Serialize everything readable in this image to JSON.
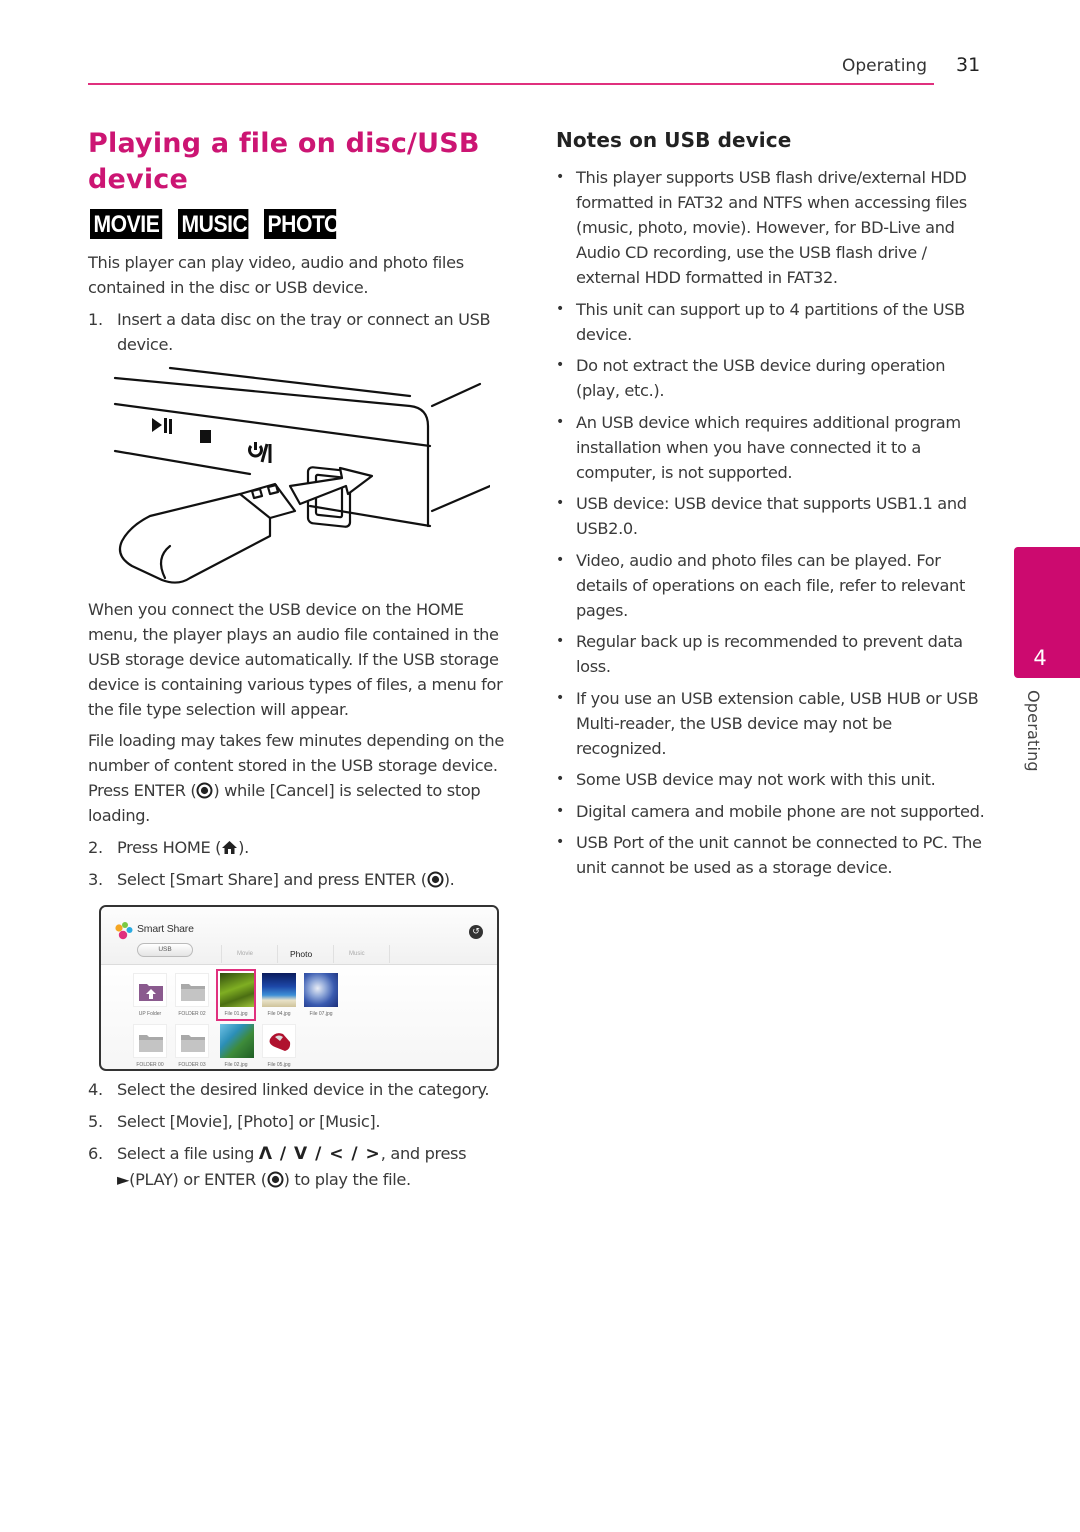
{
  "header": {
    "section": "Operating",
    "page_number": "31",
    "rule_color": "#e0307e"
  },
  "left": {
    "title": "Playing a file on disc/USB device",
    "title_color": "#cc1573",
    "badges": [
      "MOVIE",
      "MUSIC",
      "PHOTO"
    ],
    "intro": "This player can play video, audio and photo files contained in the disc or USB device.",
    "steps": [
      {
        "num": "1.",
        "text": "Insert a data disc on the tray or connect an USB device."
      },
      {
        "num": "2.",
        "text_before": "Press HOME (",
        "icon": "home-icon",
        "text_after": ")."
      },
      {
        "num": "3.",
        "text_before": "Select [Smart Share] and press ENTER (",
        "icon": "enter-icon",
        "text_after": ")."
      },
      {
        "num": "4.",
        "text": "Select the desired linked device in the category."
      },
      {
        "num": "5.",
        "text": "Select [Movie], [Photo] or [Music]."
      },
      {
        "num": "6.",
        "text_before": "Select a file using ",
        "arrows": "Λ / V / < / >",
        "text_mid": ", and press ",
        "play_symbol": "►",
        "text_line2": "(PLAY) or ENTER (",
        "icon": "enter-icon",
        "text_after": ") to play the file."
      }
    ],
    "para_home_menu": "When you connect the USB device on the HOME menu, the player plays an audio file contained in the USB storage device automatically. If the USB storage device is containing various types of files, a menu for the file type selection will appear.",
    "para_loading_before": "File loading may takes few minutes depending on the number of content stored in the USB storage device. Press ENTER (",
    "para_loading_after": ") while [Cancel] is selected to stop loading.",
    "illustration": {
      "description": "USB flash drive being inserted into player front USB port",
      "button_icons": [
        "play-pause-icon",
        "stop-icon",
        "power-icon"
      ]
    },
    "smart_share": {
      "title": "Smart Share",
      "device_button": "USB",
      "tabs": [
        "Movie",
        "Photo",
        "Music"
      ],
      "active_tab": "Photo",
      "back_icon": "back-icon",
      "items": [
        {
          "label": "UP Folder",
          "type": "up-folder"
        },
        {
          "label": "FOLDER 02",
          "type": "folder"
        },
        {
          "label": "File 01.jpg",
          "type": "photo-forest",
          "selected": true
        },
        {
          "label": "File 04.jpg",
          "type": "photo-beach"
        },
        {
          "label": "File 07.jpg",
          "type": "photo-flowers"
        },
        {
          "label": "FOLDER 00",
          "type": "folder"
        },
        {
          "label": "FOLDER 03",
          "type": "folder"
        },
        {
          "label": "File 02.jpg",
          "type": "photo-coast"
        },
        {
          "label": "File 05.jpg",
          "type": "photo-car"
        }
      ],
      "selection_color": "#e0307e"
    }
  },
  "right": {
    "notes_title": "Notes on USB device",
    "notes": [
      "This player supports USB flash drive/external HDD formatted in FAT32 and NTFS when accessing files (music, photo, movie). However, for BD-Live and Audio CD recording, use the USB flash drive / external HDD formatted in FAT32.",
      "This unit can support up to 4 partitions of the USB device.",
      "Do not extract the USB device during operation (play, etc.).",
      "An USB device which requires additional program installation when you have connected it to a computer, is not supported.",
      "USB device: USB device that supports USB1.1 and USB2.0.",
      "Video, audio and photo files can be played. For details of operations on each file, refer to relevant pages.",
      "Regular back up is recommended to prevent data loss.",
      "If you use an USB extension cable, USB HUB or USB Multi-reader, the USB device may not be recognized.",
      "Some USB device may not work with this unit.",
      "Digital camera and mobile phone are not supported.",
      "USB Port of the unit cannot be connected to PC. The unit cannot be used as a storage device."
    ],
    "bullet": "•"
  },
  "side_tab": {
    "chapter": "4",
    "label": "Operating",
    "color": "#cc0a6f"
  }
}
